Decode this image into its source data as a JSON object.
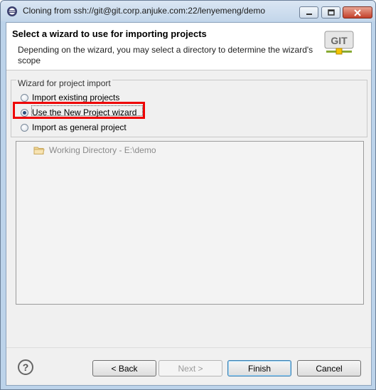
{
  "window": {
    "title": "Cloning from ssh://git@git.corp.anjuke.com:22/lenyemeng/demo"
  },
  "header": {
    "title": "Select a wizard to use for importing projects",
    "description": "Depending on the wizard, you may select a directory to determine the wizard's scope",
    "logo_text": "GIT"
  },
  "wizard_group": {
    "label": "Wizard for project import",
    "options": [
      {
        "label": "Import existing projects",
        "checked": false
      },
      {
        "label": "Use the New Project wizard",
        "checked": true
      },
      {
        "label": "Import as general project",
        "checked": false
      }
    ]
  },
  "tree": {
    "items": [
      {
        "label": "Working Directory - E:\\demo",
        "icon": "folder-icon"
      }
    ]
  },
  "footer": {
    "help_symbol": "?",
    "back_label": "< Back",
    "next_label": "Next >",
    "finish_label": "Finish",
    "cancel_label": "Cancel"
  },
  "colors": {
    "highlight": "#ee0000",
    "title_bar": "#c3d6ea",
    "close_button": "#c4402b"
  }
}
